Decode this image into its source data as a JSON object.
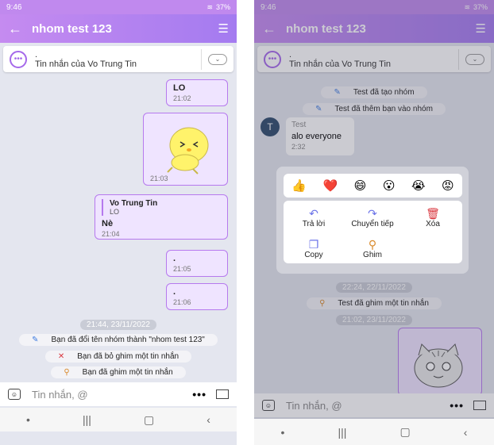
{
  "left": {
    "status": {
      "time": "9:46",
      "battery": "37%"
    },
    "appbar": {
      "title": "nhom test 123"
    },
    "pin": {
      "line1": ".",
      "line2": "Tin nhắn của Vo Trung Tin"
    },
    "messages": [
      {
        "text": "LO",
        "time": "21:02"
      },
      {
        "time": "21:03"
      },
      {
        "quote_author": "Vo Trung Tin",
        "quote_text": "LO",
        "text": "Nè",
        "time": "21:04"
      },
      {
        "text": ".",
        "time": "21:05"
      },
      {
        "text": ".",
        "time": "21:06"
      }
    ],
    "date_chip": "21:44, 23/11/2022",
    "system": [
      "Bạn đã đổi tên nhóm thành \"nhom test 123\"",
      "Bạn đã bỏ ghim một tin nhắn",
      "Bạn đã ghim một tin nhắn"
    ],
    "input_placeholder": "Tin nhắn, @"
  },
  "right": {
    "status": {
      "time": "9:46",
      "battery": "37%"
    },
    "appbar": {
      "title": "nhom test 123"
    },
    "pin": {
      "line1": ".",
      "line2": "Tin nhắn của Vo Trung Tin"
    },
    "system_top": [
      "Test đã tạo nhóm",
      "Test đã thêm bạn vào nhóm"
    ],
    "incoming": {
      "avatar": "T",
      "sender": "Test",
      "text": "alo everyone",
      "time": "2:32"
    },
    "reactions": [
      "👍",
      "❤️",
      "😄",
      "😮",
      "😭",
      "😡"
    ],
    "actions": [
      "Trả lời",
      "Chuyển tiếp",
      "Xóa",
      "Copy",
      "Ghim"
    ],
    "date_chip_1": "22:24, 22/11/2022",
    "system_pin": "Test đã ghim một tin nhắn",
    "date_chip_2": "21:02, 23/11/2022",
    "input_placeholder": "Tin nhắn, @"
  },
  "colors": {
    "accent": "#b679ee",
    "bubble": "#efe4ff",
    "delete": "#d9363e"
  }
}
